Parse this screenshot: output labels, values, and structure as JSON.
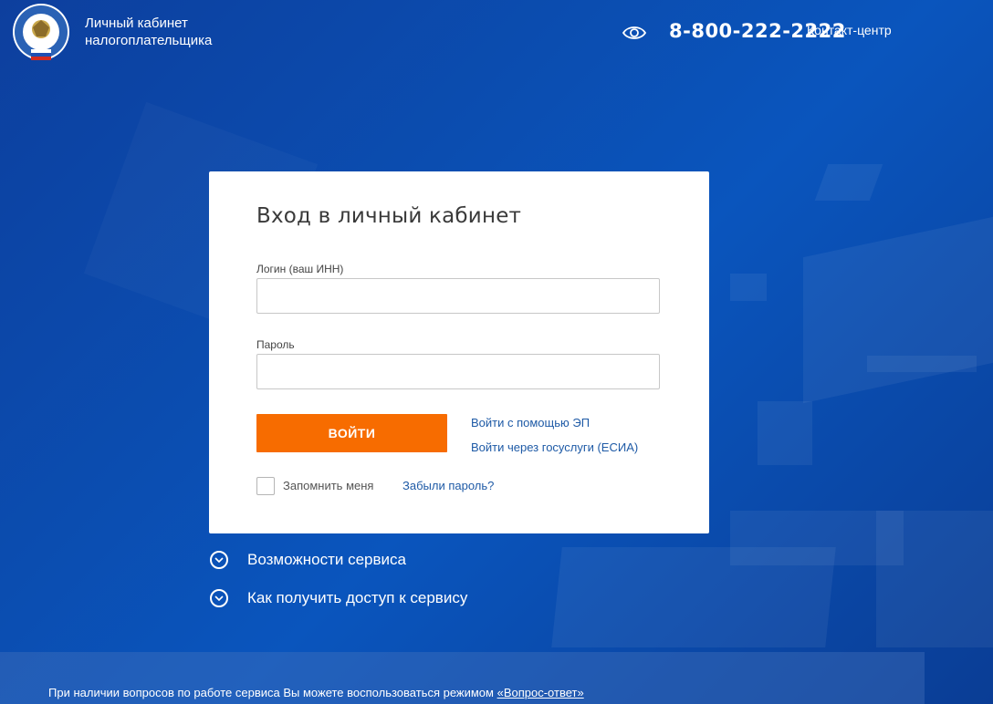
{
  "header": {
    "brand_line1": "Личный кабинет",
    "brand_line2": "налогоплательщика",
    "phone": "8-800-222-2222",
    "contact_label": "Контакт-центр"
  },
  "login": {
    "title": "Вход в личный кабинет",
    "login_label": "Логин (ваш ИНН)",
    "login_value": "",
    "password_label": "Пароль",
    "password_value": "",
    "submit_label": "ВОЙТИ",
    "ep_link": "Войти с помощью ЭП",
    "esia_link": "Войти через госуслуги (ЕСИА)",
    "remember_label": "Запомнить меня",
    "forgot_link": "Забыли пароль?"
  },
  "expanders": [
    {
      "label": "Возможности сервиса"
    },
    {
      "label": "Как получить доступ к сервису"
    }
  ],
  "footer": {
    "text": "При наличии вопросов по работе сервиса Вы можете воспользоваться режимом ",
    "link": "«Вопрос-ответ»"
  },
  "colors": {
    "accent": "#f76c00",
    "link": "#1e5aa6",
    "background": "#0b4db0"
  },
  "icons": [
    "fns-emblem-icon",
    "eye-icon",
    "chevron-down-icon",
    "checkbox-icon"
  ]
}
